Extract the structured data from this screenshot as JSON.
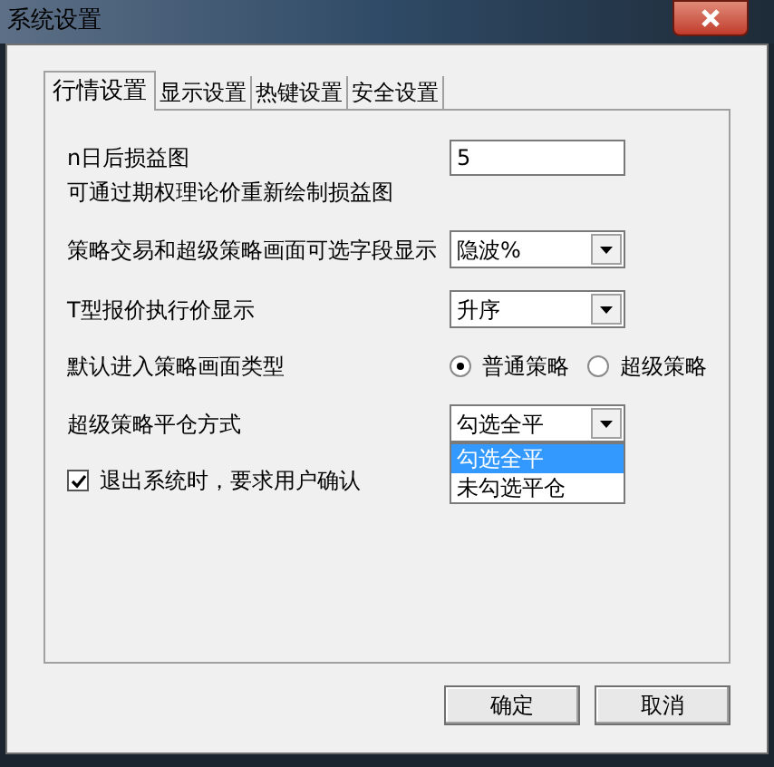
{
  "window": {
    "title": "系统设置"
  },
  "tabs": [
    {
      "label": "行情设置",
      "selected": true
    },
    {
      "label": "显示设置",
      "selected": false
    },
    {
      "label": "热键设置",
      "selected": false
    },
    {
      "label": "安全设置",
      "selected": false
    }
  ],
  "settings": [
    {
      "kind": "text",
      "label": "n日后损益图",
      "value": "5",
      "note": "可通过期权理论价重新绘制损益图"
    },
    {
      "kind": "select",
      "label": "策略交易和超级策略画面可选字段显示",
      "value": "隐波%"
    },
    {
      "kind": "select",
      "label": "T型报价执行价显示",
      "value": "升序"
    },
    {
      "kind": "radio",
      "label": "默认进入策略画面类型",
      "options": [
        {
          "label": "普通策略",
          "selected": true
        },
        {
          "label": "超级策略",
          "selected": false
        }
      ]
    },
    {
      "kind": "select",
      "label": "超级策略平仓方式",
      "value": "勾选全平",
      "options": [
        {
          "label": "勾选全平",
          "selected": true
        },
        {
          "label": "未勾选平仓",
          "selected": false
        }
      ]
    }
  ],
  "confirm_exit": {
    "label": "退出系统时，要求用户确认",
    "checked": true
  },
  "buttons": [
    "确定",
    "取消"
  ]
}
